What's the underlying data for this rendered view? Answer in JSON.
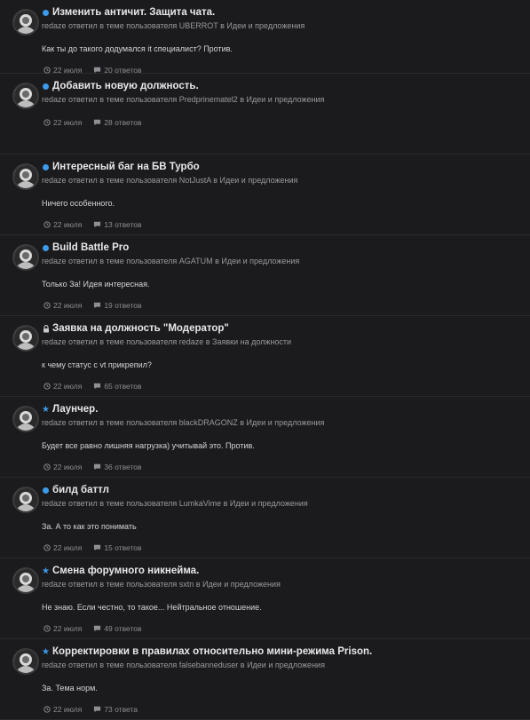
{
  "activity": {
    "items": [
      {
        "status": "unread-dot",
        "title": "Изменить античит. Защита чата.",
        "meta": "redaze ответил в теме пользователя UBERROT в Идеи и предложения",
        "excerpt": "Как ты до такого додумался it специалист? Против.",
        "date": "22 июля",
        "replies": "20 ответов"
      },
      {
        "status": "unread-dot",
        "title": "Добавить новую должность.",
        "meta": "redaze ответил в теме пользователя Predprinematel2 в Идеи и предложения",
        "excerpt": "",
        "date": "22 июля",
        "replies": "28 ответов"
      },
      {
        "status": "unread-dot",
        "title": "Интересный баг на БВ Турбо",
        "meta": "redaze ответил в теме пользователя NotJustA в Идеи и предложения",
        "excerpt": "Ничего особенного.",
        "date": "22 июля",
        "replies": "13 ответов"
      },
      {
        "status": "unread-dot",
        "title": "Build Battle Pro",
        "meta": "redaze ответил в теме пользователя AGATUM в Идеи и предложения",
        "excerpt": "Только За! Идея интересная.",
        "date": "22 июля",
        "replies": "19 ответов"
      },
      {
        "status": "lock",
        "title": "Заявка на должность \"Модератор\"",
        "meta": "redaze ответил в теме пользователя redaze в Заявки на должности",
        "excerpt": "к чему статус с vt прикрепил?",
        "date": "22 июля",
        "replies": "65 ответов"
      },
      {
        "status": "star",
        "title": "Лаунчер.",
        "meta": "redaze ответил в теме пользователя blackDRAGONZ в Идеи и предложения",
        "excerpt": "Будет все равно лишняя нагрузка) учитывай это. Против.",
        "date": "22 июля",
        "replies": "36 ответов"
      },
      {
        "status": "unread-dot",
        "title": "билд баттл",
        "meta": "redaze ответил в теме пользователя LumkaVime в Идеи и предложения",
        "excerpt": "За. А то как это понимать",
        "date": "22 июля",
        "replies": "15 ответов"
      },
      {
        "status": "star",
        "title": "Смена форумного никнейма.",
        "meta": "redaze ответил в теме пользователя sxtn в Идеи и предложения",
        "excerpt": "Не знаю. Если честно, то такое... Нейтральное отношение.",
        "date": "22 июля",
        "replies": "49 ответов"
      },
      {
        "status": "star",
        "title": "Корректировки в правилах относительно мини-режима Prison.",
        "meta": "redaze ответил в теме пользователя falsebanneduser в Идеи и предложения",
        "excerpt": "За. Тема норм.",
        "date": "22 июля",
        "replies": "73 ответа"
      }
    ]
  },
  "icons": {
    "date": "clock-icon",
    "replies": "comment-icon",
    "unread": "unread-dot-icon",
    "lock": "lock-icon",
    "star": "star-icon"
  },
  "colors": {
    "background": "#1b1b1d",
    "accent": "#3d9be9",
    "title": "#e8e8ea",
    "meta": "#9a9aa0"
  }
}
